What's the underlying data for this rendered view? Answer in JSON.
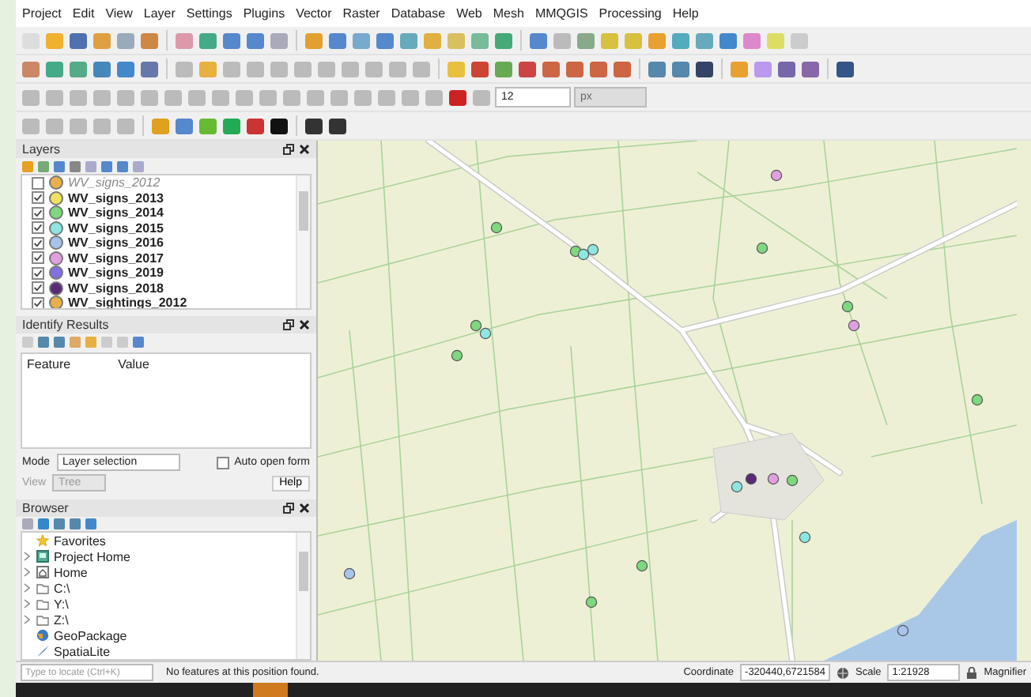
{
  "menu": [
    "Project",
    "Edit",
    "View",
    "Layer",
    "Settings",
    "Plugins",
    "Vector",
    "Raster",
    "Database",
    "Web",
    "Mesh",
    "MMQGIS",
    "Processing",
    "Help"
  ],
  "toolbar_fields": {
    "font_size": "12",
    "unit": "px"
  },
  "layers_panel": {
    "title": "Layers",
    "items": [
      {
        "name": "WV_signs_2012",
        "checked": false,
        "color": "#e8b04a"
      },
      {
        "name": "WV_signs_2013",
        "checked": true,
        "color": "#f0e060"
      },
      {
        "name": "WV_signs_2014",
        "checked": true,
        "color": "#7ed87e"
      },
      {
        "name": "WV_signs_2015",
        "checked": true,
        "color": "#8ee6e0"
      },
      {
        "name": "WV_signs_2016",
        "checked": true,
        "color": "#a8c4ec"
      },
      {
        "name": "WV_signs_2017",
        "checked": true,
        "color": "#e0a0e0"
      },
      {
        "name": "WV_signs_2019",
        "checked": true,
        "color": "#8070e0"
      },
      {
        "name": "WV_signs_2018",
        "checked": true,
        "color": "#5a2a78"
      },
      {
        "name": "WV_sightings_2012",
        "checked": true,
        "color": "#e8b04a"
      }
    ]
  },
  "identify_panel": {
    "title": "Identify Results",
    "columns": [
      "Feature",
      "Value"
    ],
    "mode_label": "Mode",
    "mode": "Layer selection",
    "view_label": "View",
    "view": "Tree",
    "auto_open_form": {
      "label": "Auto open form",
      "checked": false
    },
    "help_button": "Help"
  },
  "browser_panel": {
    "title": "Browser",
    "items": [
      {
        "label": "Favorites",
        "kind": "star",
        "expandable": false
      },
      {
        "label": "Project Home",
        "kind": "project",
        "expandable": true
      },
      {
        "label": "Home",
        "kind": "home",
        "expandable": true
      },
      {
        "label": "C:\\",
        "kind": "folder",
        "expandable": true
      },
      {
        "label": "Y:\\",
        "kind": "folder",
        "expandable": true
      },
      {
        "label": "Z:\\",
        "kind": "folder",
        "expandable": true
      },
      {
        "label": "GeoPackage",
        "kind": "geopackage",
        "expandable": false
      },
      {
        "label": "SpatiaLite",
        "kind": "spatialite",
        "expandable": false
      }
    ]
  },
  "status_bar": {
    "locator_placeholder": "Type to locate (Ctrl+K)",
    "message": "No features at this position found.",
    "coordinate_label": "Coordinate",
    "coordinate": "-320440,6721584",
    "scale_label": "Scale",
    "scale": "1:21928",
    "magnifier_label": "Magnifier"
  }
}
